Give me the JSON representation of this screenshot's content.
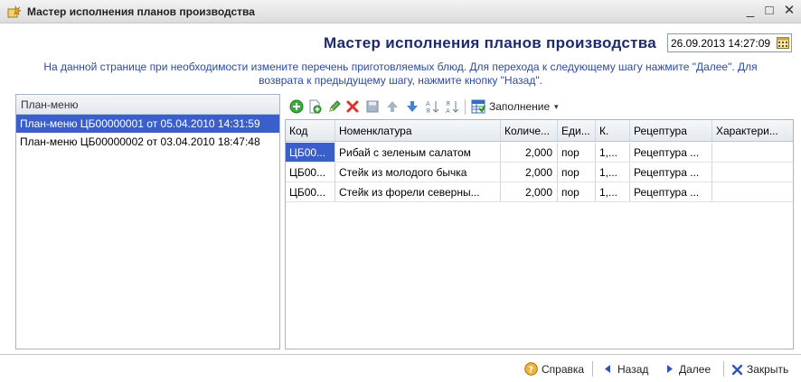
{
  "window": {
    "title": "Мастер исполнения планов производства",
    "controls": {
      "minimize": "_",
      "maximize": "□",
      "close": "✕"
    }
  },
  "header": {
    "heading": "Мастер исполнения планов производства",
    "date_value": "26.09.2013 14:27:09"
  },
  "description": {
    "line1": "На данной странице при необходимости измените перечень приготовляемых блюд. Для перехода к следующему шагу нажмите \"Далее\". Для",
    "line2": "возврата к предыдущему шагу, нажмите кнопку \"Назад\"."
  },
  "plan_list": {
    "header": "План-меню",
    "items": [
      {
        "label": "План-меню ЦБ00000001 от 05.04.2010 14:31:59",
        "selected": true
      },
      {
        "label": "План-меню ЦБ00000002 от 03.04.2010 18:47:48",
        "selected": false
      }
    ]
  },
  "toolbar": {
    "icons": [
      "add-icon",
      "copy-icon",
      "edit-icon",
      "delete-icon",
      "save-icon",
      "move-up-icon",
      "move-down-icon",
      "sort-asc-icon",
      "sort-desc-icon"
    ],
    "fill_label": "Заполнение"
  },
  "table": {
    "columns": [
      "Код",
      "Номенклатура",
      "Количе...",
      "Еди...",
      "К.",
      "Рецептура",
      "Характери..."
    ],
    "rows": [
      {
        "code": "ЦБ00...",
        "name": "Рибай с зеленым салатом",
        "qty": "2,000",
        "unit": "пор",
        "k": "1,...",
        "recipe": "Рецептура ...",
        "char": ""
      },
      {
        "code": "ЦБ00...",
        "name": "Стейк из молодого бычка",
        "qty": "2,000",
        "unit": "пор",
        "k": "1,...",
        "recipe": "Рецептура ...",
        "char": ""
      },
      {
        "code": "ЦБ00...",
        "name": "Стейк из форели северны...",
        "qty": "2,000",
        "unit": "пор",
        "k": "1,...",
        "recipe": "Рецептура ...",
        "char": ""
      }
    ]
  },
  "footer": {
    "help": "Справка",
    "back": "Назад",
    "next": "Далее",
    "close": "Закрыть"
  },
  "colors": {
    "selection": "#3a5fcd",
    "heading": "#1c2b6b",
    "description": "#2b4aa6"
  }
}
